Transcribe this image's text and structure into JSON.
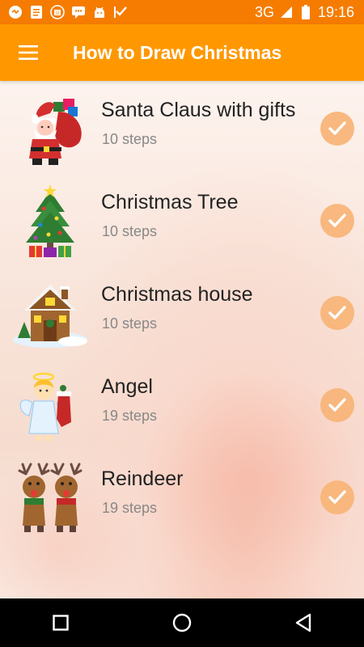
{
  "status_bar": {
    "network": "3G",
    "time": "19:16",
    "icons": [
      "chat-icon",
      "document-icon",
      "calendar-icon",
      "message-icon",
      "android-icon",
      "check-flag-icon"
    ]
  },
  "toolbar": {
    "title": "How to Draw Christmas",
    "menu_icon": "hamburger-menu-icon"
  },
  "lessons": [
    {
      "title": "Santa Claus with gifts",
      "steps": "10 steps",
      "icon": "santa-claus-icon",
      "completed": true
    },
    {
      "title": "Christmas Tree",
      "steps": "10 steps",
      "icon": "christmas-tree-icon",
      "completed": true
    },
    {
      "title": "Christmas house",
      "steps": "10 steps",
      "icon": "christmas-house-icon",
      "completed": true
    },
    {
      "title": "Angel",
      "steps": "19 steps",
      "icon": "angel-icon",
      "completed": true
    },
    {
      "title": "Reindeer",
      "steps": "19 steps",
      "icon": "reindeer-icon",
      "completed": true
    }
  ],
  "colors": {
    "status_bar": "#f57c00",
    "toolbar": "#ff9800",
    "check_badge": "#f8b67a"
  },
  "nav_bar": {
    "buttons": [
      "recents-square-icon",
      "home-circle-icon",
      "back-triangle-icon"
    ]
  }
}
